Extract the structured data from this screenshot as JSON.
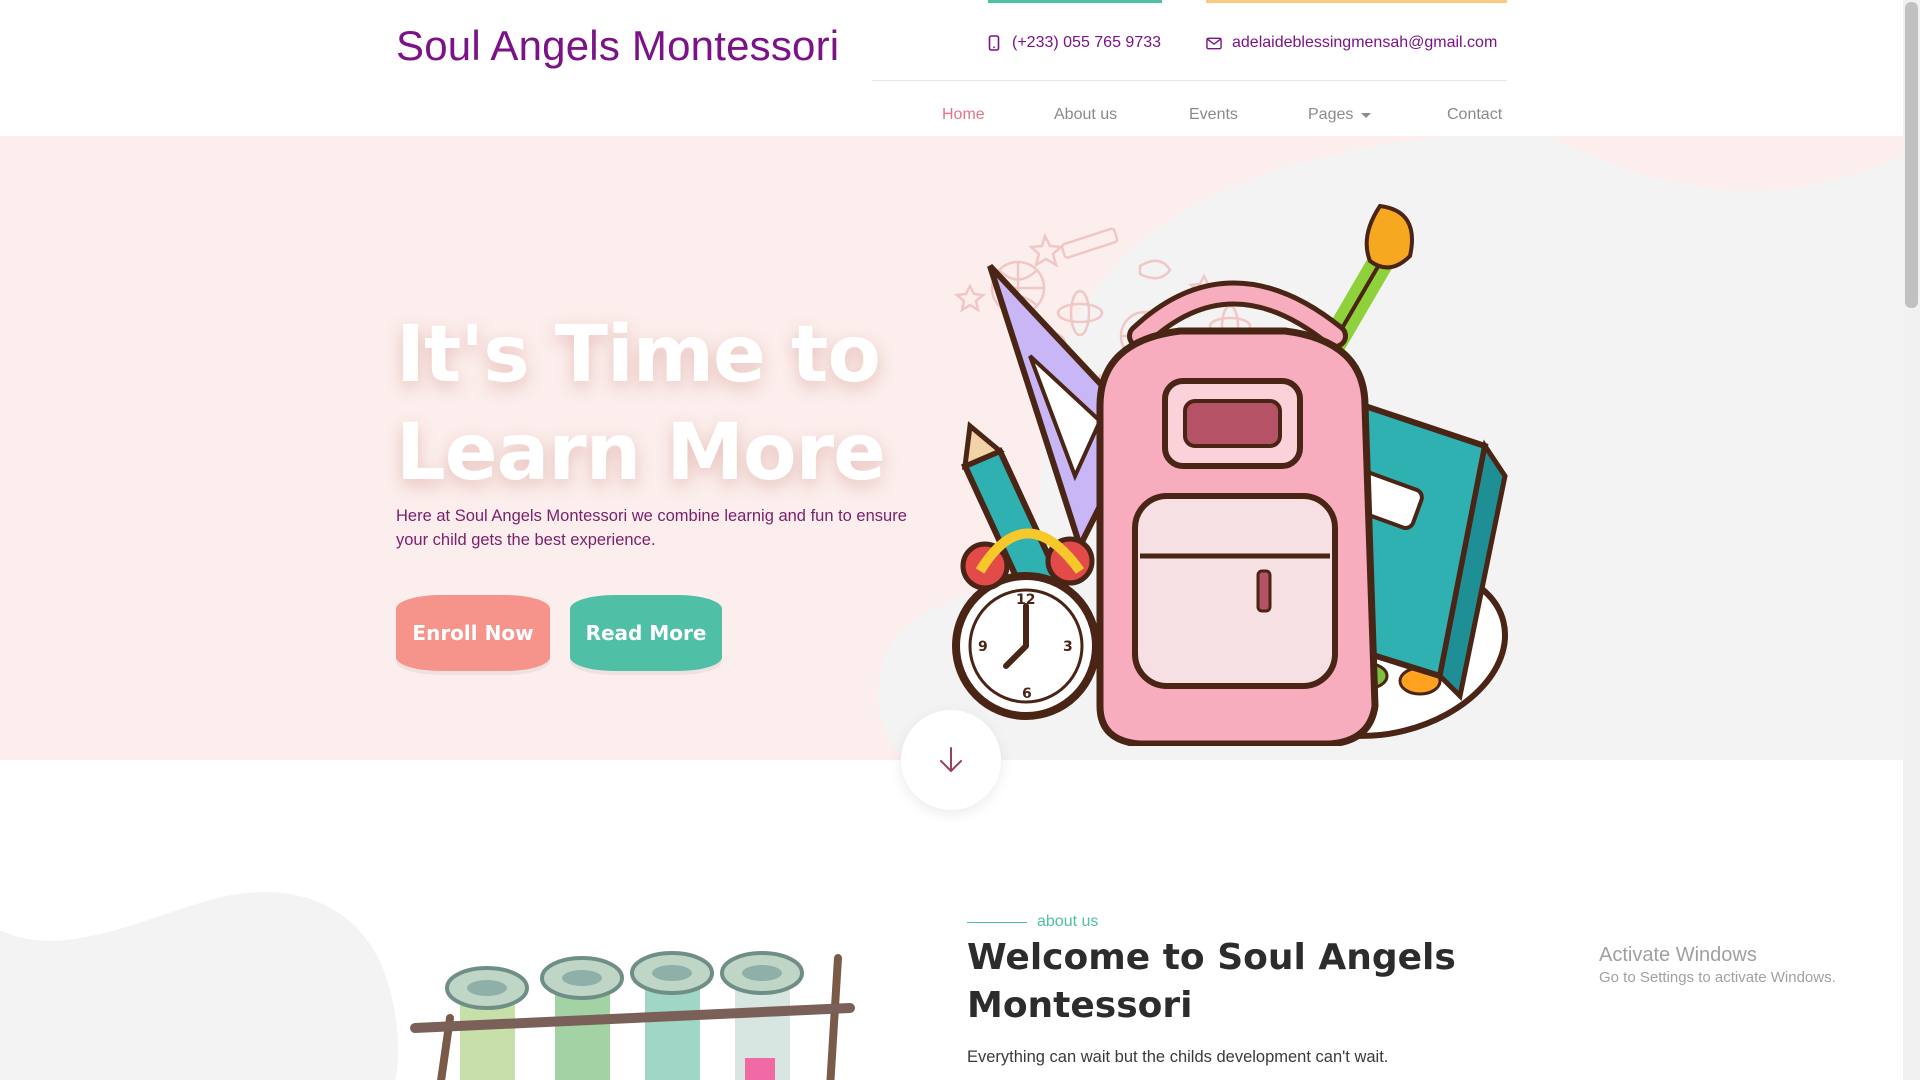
{
  "brand": {
    "name": "Soul Angels Montessori",
    "color": "#7b1287"
  },
  "contact": {
    "phone": "(+233) 055 765 9733",
    "email": "adelaideblessingmensah@gmail.com",
    "phone_icon": "mobile-phone-icon",
    "email_icon": "envelope-icon"
  },
  "nav": {
    "items": [
      {
        "label": "Home",
        "active": true
      },
      {
        "label": "About us"
      },
      {
        "label": "Events"
      },
      {
        "label": "Pages",
        "has_dropdown": true
      },
      {
        "label": "Contact"
      }
    ],
    "active_color": "#e3728a"
  },
  "hero": {
    "title_line1": "It's Time to",
    "title_line2": "Learn More",
    "text": "Here at Soul Angels Montessori we combine learnig and fun to ensure your child gets the best experience.",
    "enroll_label": "Enroll Now",
    "read_label": "Read More",
    "illustration": "school-backpack-illustration",
    "scroll_icon": "arrow-down-icon",
    "colors": {
      "background": "#fbeeec",
      "enroll": "#f6938b",
      "read": "#4fbfa5"
    }
  },
  "about": {
    "kicker": "about us",
    "title": "Welcome to Soul Angels Montessori",
    "text": "Everything can wait but the childs development can't wait.",
    "illustration": "test-tubes-illustration"
  },
  "watermark": {
    "title": "Activate Windows",
    "subtitle": "Go to Settings to activate Windows."
  }
}
